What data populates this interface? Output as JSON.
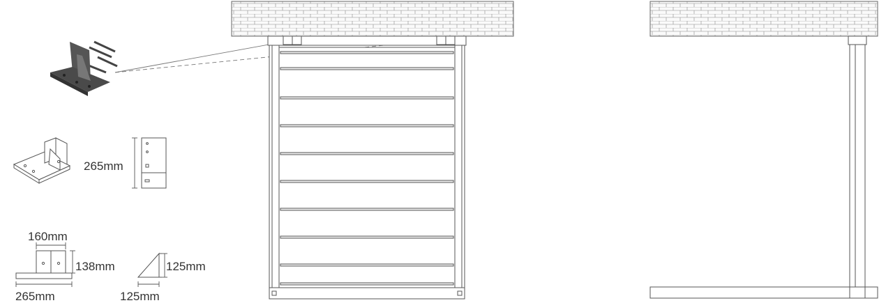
{
  "labels": {
    "plate_height": "265mm",
    "top_width": "160mm",
    "side_height": "138mm",
    "base_width": "265mm",
    "gusset_height": "125mm",
    "gusset_width": "125mm"
  },
  "colors": {
    "line": "#555555",
    "metal_dark": "#4a4a4a",
    "metal_light": "#777777",
    "brick_fill": "#fafafa"
  },
  "icons": {
    "bracket_photo": "steel-angle-bracket-icon",
    "bracket_iso": "bracket-isometric-icon"
  }
}
